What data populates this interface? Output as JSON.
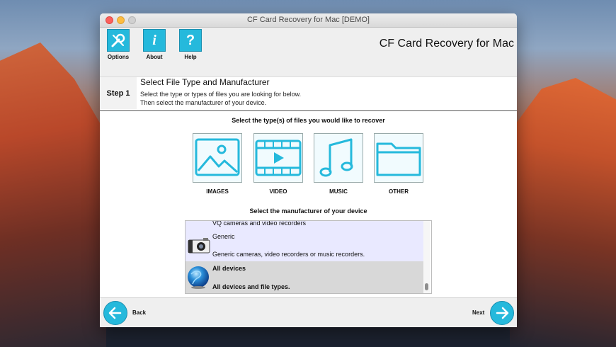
{
  "window": {
    "title": "CF Card Recovery for Mac [DEMO]"
  },
  "toolbar": {
    "options_label": "Options",
    "about_label": "About",
    "about_glyph": "i",
    "help_label": "Help",
    "help_glyph": "?",
    "app_title": "CF Card Recovery for Mac"
  },
  "step": {
    "label": "Step 1",
    "title": "Select File Type and Manufacturer",
    "desc_line1": "Select the type or types of files you are looking for below.",
    "desc_line2": "Then select the manufacturer of your device."
  },
  "file_types": {
    "heading": "Select the type(s) of files you would like to recover",
    "items": [
      {
        "label": "IMAGES",
        "icon": "image-icon"
      },
      {
        "label": "VIDEO",
        "icon": "video-icon"
      },
      {
        "label": "MUSIC",
        "icon": "music-icon"
      },
      {
        "label": "OTHER",
        "icon": "folder-icon"
      }
    ]
  },
  "manufacturer": {
    "heading": "Select the manufacturer of your device",
    "items": [
      {
        "name": "",
        "desc": "VQ cameras and video recorders"
      },
      {
        "name": "Generic",
        "desc": "Generic cameras, video recorders or music recorders."
      },
      {
        "name": "All devices",
        "desc": "All devices and file types.",
        "selected": true
      }
    ]
  },
  "nav": {
    "back_label": "Back",
    "next_label": "Next"
  },
  "colors": {
    "accent": "#25b9dc",
    "list_highlight": "#e9e9ff",
    "list_selected": "#d8d8d8"
  }
}
